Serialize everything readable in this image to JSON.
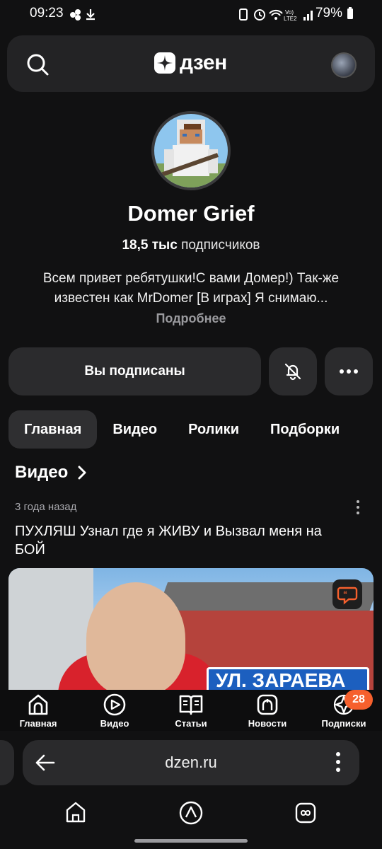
{
  "status_bar": {
    "time": "09:23",
    "battery": "79%"
  },
  "header": {
    "logo": "дзен"
  },
  "channel": {
    "name": "Domer Grief",
    "subscribers_count": "18,5 тыс",
    "subscribers_label": "подписчиков",
    "description": "Всем привет ребятушки!С вами Домер!) Так-же известен как MrDomer [В играх] Я снимаю...",
    "more_label": "Подробнее"
  },
  "actions": {
    "subscribed_label": "Вы подписаны"
  },
  "tabs": [
    {
      "label": "Главная",
      "active": true
    },
    {
      "label": "Видео"
    },
    {
      "label": "Ролики"
    },
    {
      "label": "Подборки"
    }
  ],
  "section": {
    "title": "Видео"
  },
  "post": {
    "date": "3 года назад",
    "title": "ПУХЛЯШ Узнал где я ЖИВУ и Вызвал меня на БОЙ",
    "thumb_sign_text": "УЛ. ЗАРАЕВА"
  },
  "bottom_nav": [
    {
      "label": "Главная",
      "icon": "home-icon"
    },
    {
      "label": "Видео",
      "icon": "play-icon"
    },
    {
      "label": "Статьи",
      "icon": "book-icon"
    },
    {
      "label": "Новости",
      "icon": "news-icon"
    },
    {
      "label": "Подписки",
      "icon": "subscriptions-icon"
    }
  ],
  "subscriptions_badge": "28",
  "browser": {
    "url": "dzen.ru"
  },
  "colors": {
    "accent": "#f6602d",
    "background": "#111112",
    "card": "#2b2b2d"
  }
}
